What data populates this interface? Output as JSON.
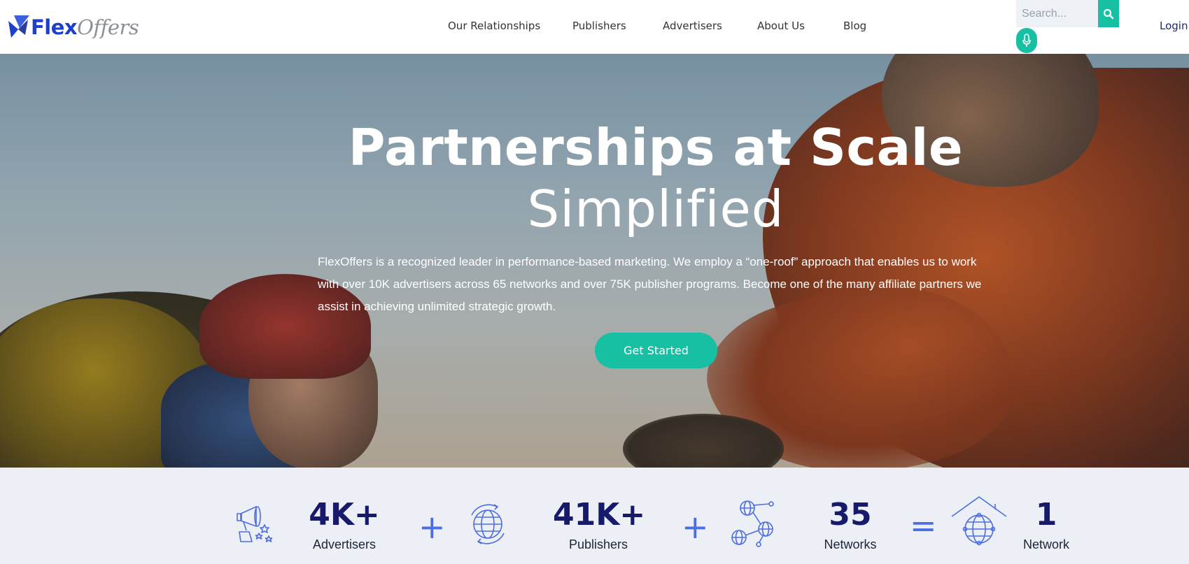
{
  "brand": {
    "name_part1": "Flex",
    "name_part2": "Offers"
  },
  "nav": {
    "items": [
      {
        "label": "Our Relationships"
      },
      {
        "label": "Publishers"
      },
      {
        "label": "Advertisers"
      },
      {
        "label": "About Us"
      },
      {
        "label": "Blog"
      }
    ]
  },
  "search": {
    "placeholder": "Search..."
  },
  "login": {
    "label": "Login"
  },
  "hero": {
    "title_line1": "Partnerships at Scale",
    "title_line2": "Simplified",
    "description": "FlexOffers is a recognized leader in performance-based marketing. We employ a “one-roof” approach that enables us to work with over 10K advertisers across 65 networks and over 75K publisher programs. Become one of the many affiliate partners we assist in achieving unlimited strategic growth.",
    "cta_label": "Get Started"
  },
  "stats": {
    "items": [
      {
        "number": "4K+",
        "label": "Advertisers",
        "icon": "megaphone-icon"
      },
      {
        "number": "41K+",
        "label": "Publishers",
        "icon": "globe-cycle-icon"
      },
      {
        "number": "35",
        "label": "Networks",
        "icon": "network-nodes-icon"
      },
      {
        "number": "1",
        "label": "Network",
        "icon": "house-globe-icon"
      }
    ],
    "operators": [
      "+",
      "+",
      "="
    ]
  },
  "colors": {
    "accent": "#17bfa3",
    "brand_blue": "#1d3fc9",
    "stat_number": "#17196a",
    "operator": "#4d6ee0",
    "stats_bg": "#eceff5"
  }
}
